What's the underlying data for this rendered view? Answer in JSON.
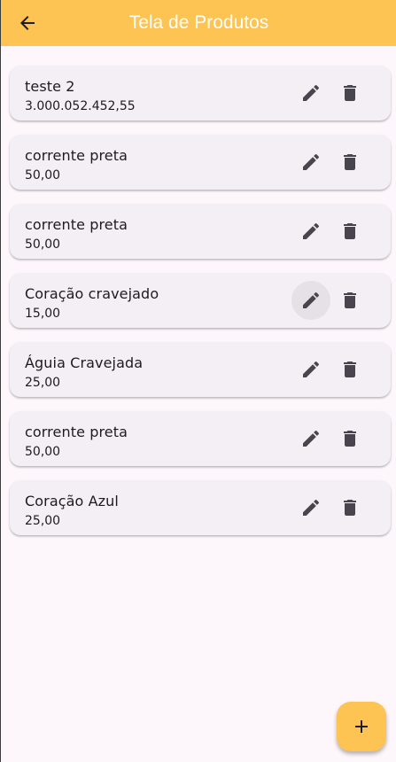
{
  "app_bar": {
    "title": "Tela de Produtos",
    "back_icon": "arrow-back-icon",
    "background": "#fdc453",
    "title_color": "#ffffff"
  },
  "products": [
    {
      "name": "teste 2",
      "price": "3.000.052.452,55"
    },
    {
      "name": "corrente preta",
      "price": "50,00"
    },
    {
      "name": "corrente preta",
      "price": "50,00"
    },
    {
      "name": "Coração cravejado",
      "price": "15,00",
      "edit_hovered": true
    },
    {
      "name": "Águia Cravejada",
      "price": "25,00"
    },
    {
      "name": "corrente preta",
      "price": "50,00"
    },
    {
      "name": "Coração Azul",
      "price": "25,00"
    }
  ],
  "item_actions": {
    "edit_icon": "pencil-icon",
    "delete_icon": "trash-icon",
    "icon_color": "#49454f"
  },
  "fab": {
    "icon": "plus-icon",
    "background": "#fdc453"
  },
  "colors": {
    "page_background": "#fdf7fb",
    "card_background": "#f4eff4"
  }
}
